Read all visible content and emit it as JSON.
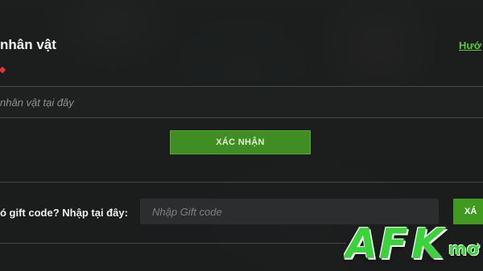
{
  "colors": {
    "accent_green": "#3f8d23",
    "link_green": "#5cc93a",
    "logo_green": "#3bd33b"
  },
  "character_section": {
    "title": "nhân vật",
    "guide_link": "Hướ",
    "input_placeholder": "nhân vật tại đây",
    "confirm_button": "XÁC NHẬN"
  },
  "gift_section": {
    "label": "ó gift code? Nhập tại đây:",
    "input_placeholder": "Nhập Gift code",
    "button": "XÁ"
  },
  "watermark": {
    "letter_a": "A",
    "letter_f": "F",
    "letter_k": "K",
    "suffix": "mơ"
  }
}
